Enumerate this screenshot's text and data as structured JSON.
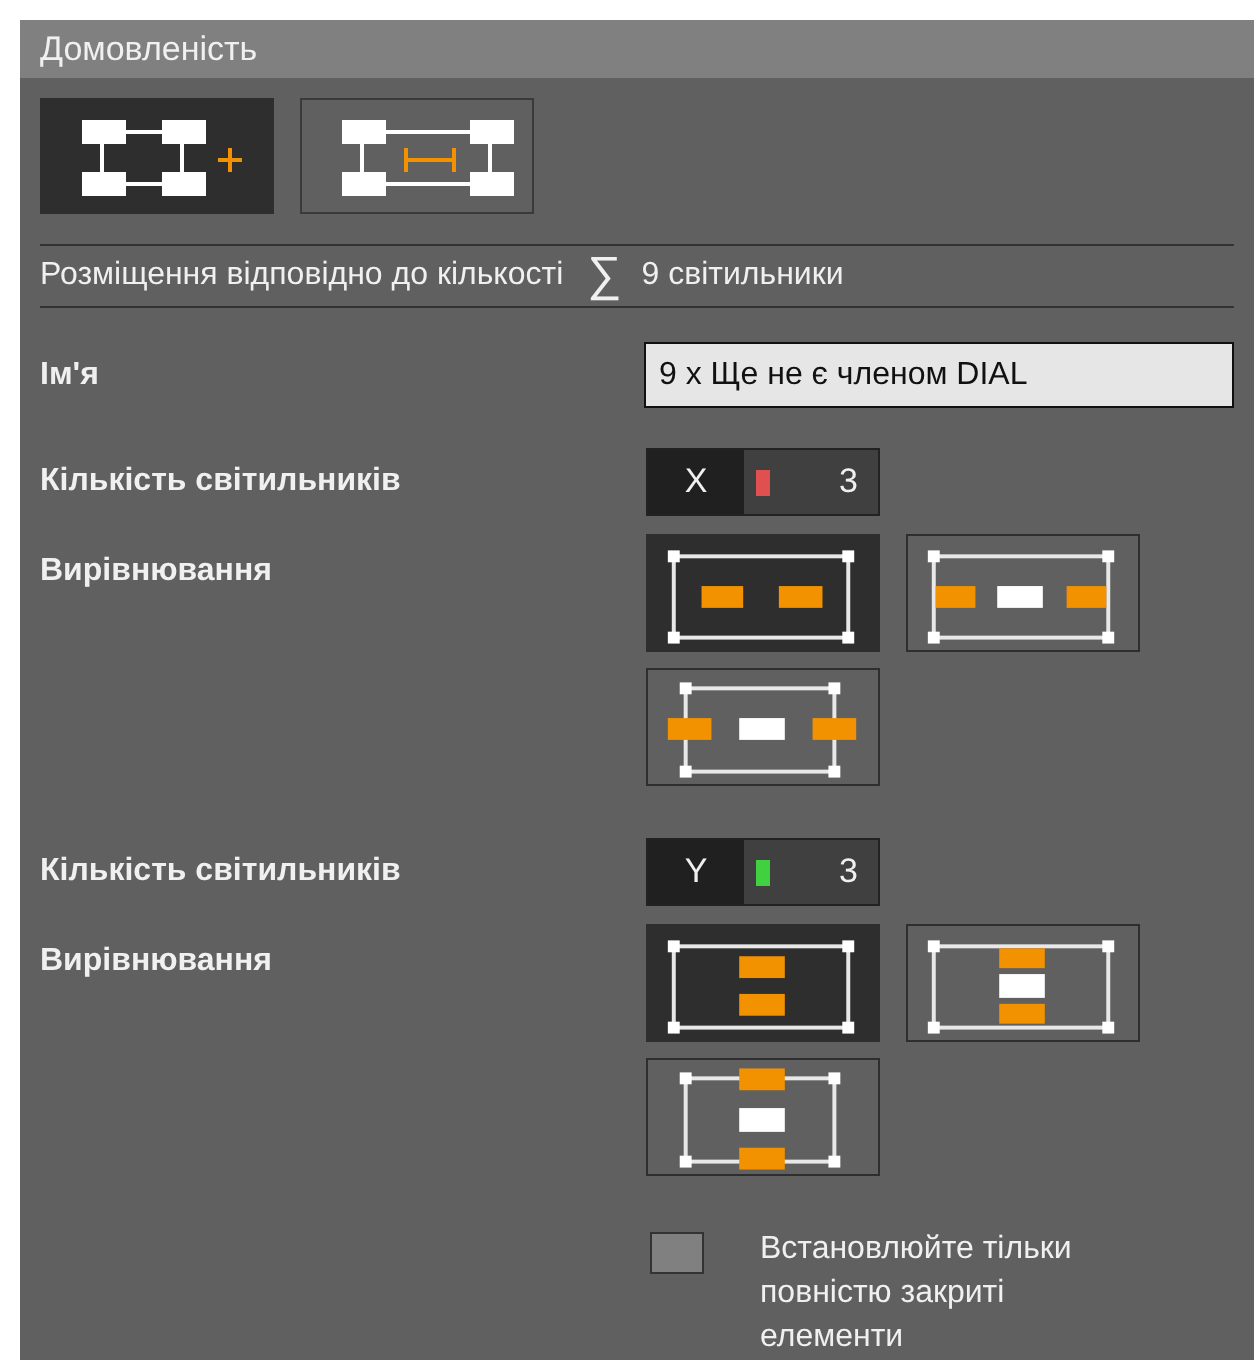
{
  "panel": {
    "title": "Домовленість"
  },
  "modes": [
    {
      "kind": "add",
      "selected": true
    },
    {
      "kind": "spacing",
      "selected": false
    }
  ],
  "arrangement": {
    "label": "Розміщення відповідно до кількості",
    "sum_symbol": "∑",
    "value": "9 світильники"
  },
  "name": {
    "label": "Ім'я",
    "value": "9 x Ще не є членом DIAL"
  },
  "axes": [
    {
      "count_label": "Кількість світильників",
      "axis": "X",
      "color": "#e05050",
      "count": "3",
      "vertical": false,
      "alignment_label": "Вирівнювання",
      "options": [
        {
          "kind": "edges",
          "selected": true
        },
        {
          "kind": "center",
          "selected": false
        },
        {
          "kind": "overhang",
          "selected": false
        }
      ]
    },
    {
      "count_label": "Кількість світильників",
      "axis": "Y",
      "color": "#40d040",
      "count": "3",
      "vertical": true,
      "alignment_label": "Вирівнювання",
      "options": [
        {
          "kind": "edges",
          "selected": true
        },
        {
          "kind": "center",
          "selected": false
        },
        {
          "kind": "overhang",
          "selected": false
        }
      ]
    }
  ],
  "closed_only": {
    "label": "Встановлюйте тільки повністю закриті елементи",
    "checked": false
  }
}
